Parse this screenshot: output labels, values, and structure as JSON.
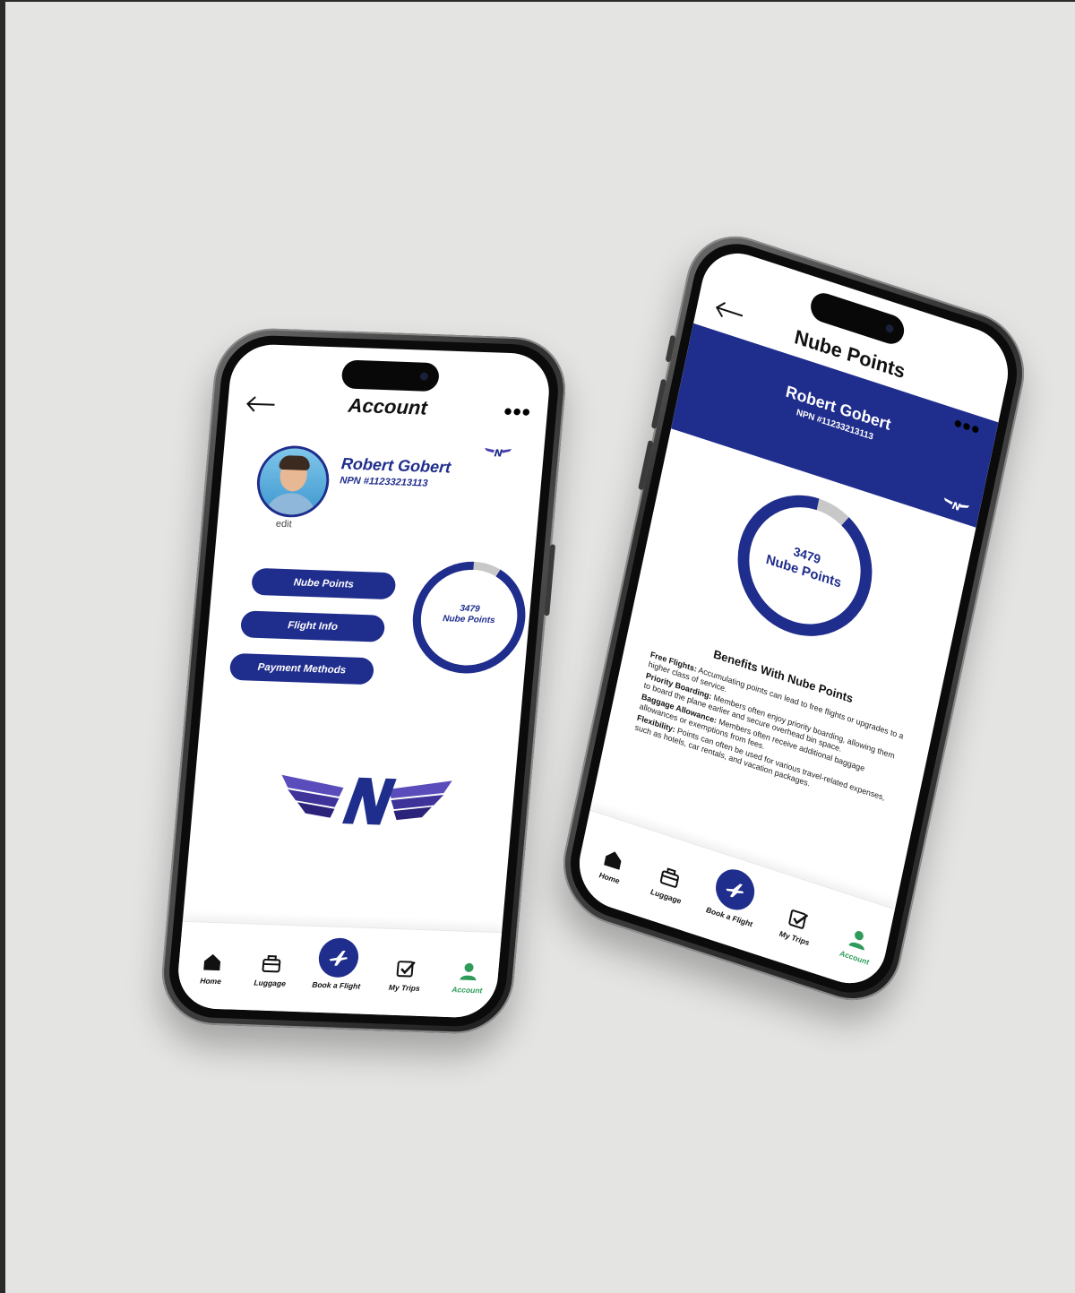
{
  "colors": {
    "brand_blue": "#1f2d8c",
    "active_green": "#2e9b5a",
    "ring_gray": "#c8c8c8",
    "background": "#e4e4e3"
  },
  "account_screen": {
    "title": "Account",
    "back_icon": "back-arrow-icon",
    "more_icon": "more-dots-icon",
    "more_text": "•••",
    "profile": {
      "name": "Robert Gobert",
      "npn": "NPN #11233213113",
      "edit_label": "edit"
    },
    "menu": [
      {
        "label": "Nube Points"
      },
      {
        "label": "Flight Info"
      },
      {
        "label": "Payment Methods"
      }
    ],
    "points": {
      "value": "3479",
      "label": "Nube Points",
      "fraction": 0.92
    },
    "tabs": [
      {
        "label": "Home",
        "icon": "home-icon"
      },
      {
        "label": "Luggage",
        "icon": "luggage-icon"
      },
      {
        "label": "Book a Flight",
        "icon": "plane-icon"
      },
      {
        "label": "My Trips",
        "icon": "checkbox-icon"
      },
      {
        "label": "Account",
        "icon": "user-icon",
        "active": true
      }
    ]
  },
  "points_screen": {
    "title": "Nube Points",
    "more_text": "•••",
    "profile": {
      "name": "Robert Gobert",
      "npn": "NPN #11233213113"
    },
    "points": {
      "value": "3479",
      "label": "Nube Points",
      "fraction": 0.92
    },
    "benefits_title": "Benefits With Nube Points",
    "benefits": [
      {
        "term": "Free Flights:",
        "text": "Accumulating points can lead to free flights or upgrades to a higher class of service."
      },
      {
        "term": "Priority Boarding:",
        "text": "Members often enjoy priority boarding, allowing them to board the plane earlier and secure overhead bin space."
      },
      {
        "term": "Baggage Allowance:",
        "text": "Members often receive additional baggage allowances or exemptions from fees."
      },
      {
        "term": "Flexibility:",
        "text": "Points can often be used for various travel-related expenses, such as hotels, car rentals, and vacation packages."
      }
    ],
    "tabs": [
      {
        "label": "Home",
        "icon": "home-icon"
      },
      {
        "label": "Luggage",
        "icon": "luggage-icon"
      },
      {
        "label": "Book a Flight",
        "icon": "plane-icon"
      },
      {
        "label": "My Trips",
        "icon": "checkbox-icon"
      },
      {
        "label": "Account",
        "icon": "user-icon",
        "active": true
      }
    ]
  }
}
